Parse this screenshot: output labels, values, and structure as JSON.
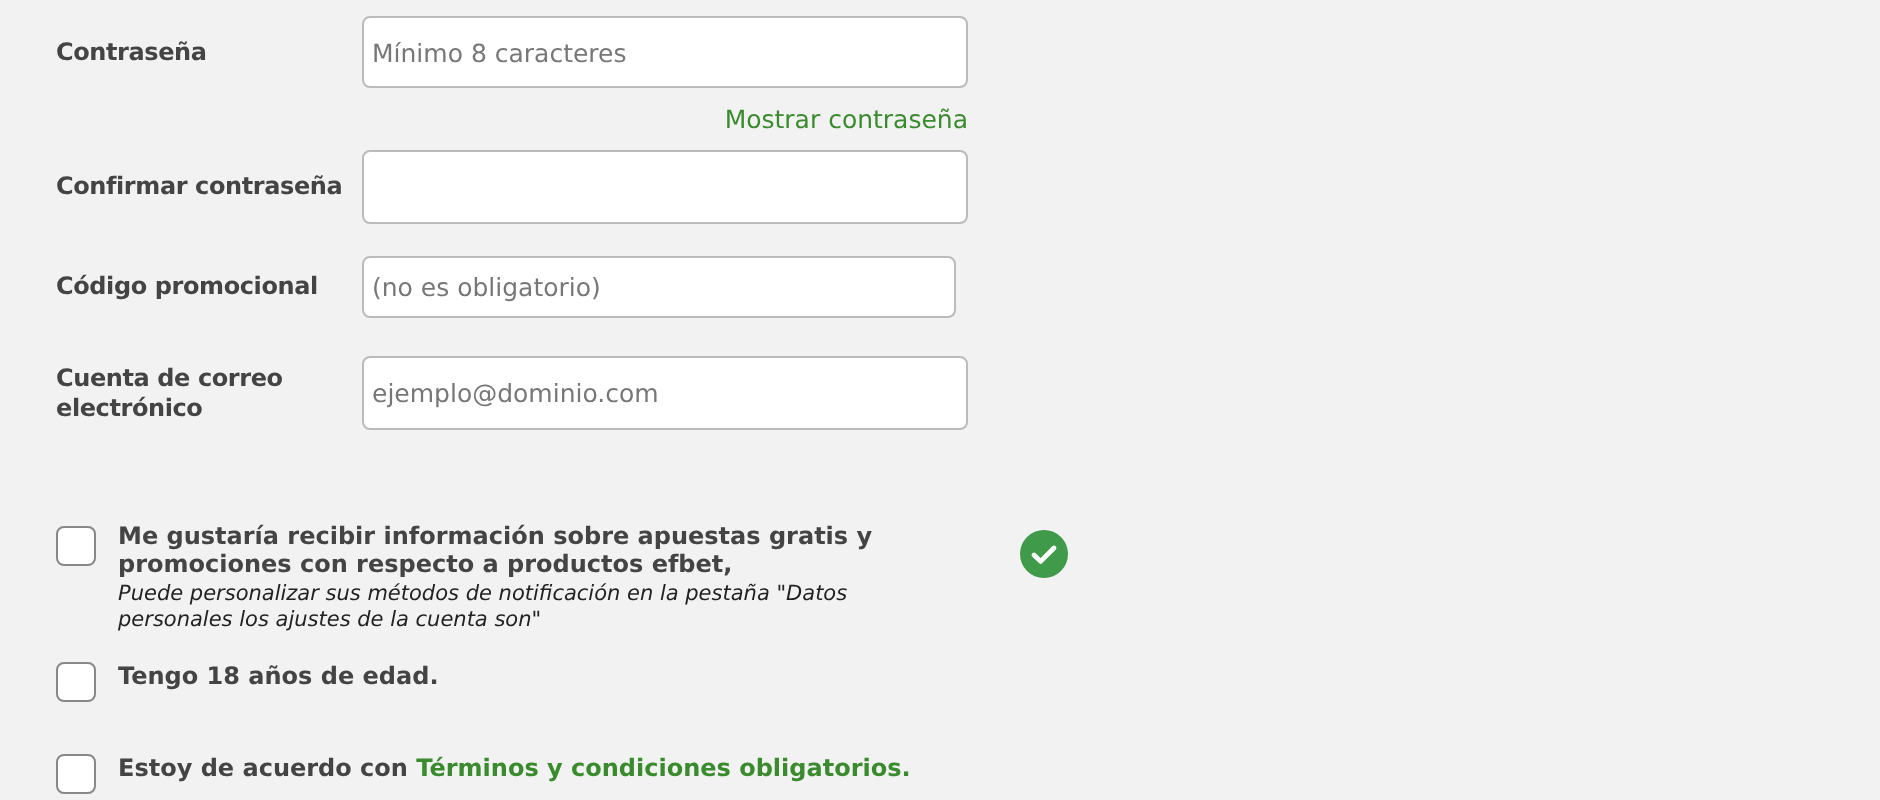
{
  "fields": [
    {
      "label": "Contraseña",
      "placeholder": "Mínimo 8 caracteres",
      "link": "Mostrar contraseña"
    },
    {
      "label": "Confirmar contraseña"
    },
    {
      "label": "Código promocional",
      "placeholder": "(no es obligatorio)"
    },
    {
      "label": "Cuenta de correo electrónico",
      "placeholder": "ejemplo@dominio.com"
    }
  ],
  "agreements": [
    {
      "text": "Me gustaría recibir información sobre apuestas gratis y promociones con respecto a productos efbet,",
      "note": "Puede personalizar sus métodos de notificación en la pestaña \"Datos personales los ajustes de la cuenta son\"",
      "checked": false,
      "valid": true
    },
    {
      "text": "Tengo 18 años de edad.",
      "checked": false,
      "valid": false
    },
    {
      "text": "Estoy de acuerdo con",
      "link": "Términos y condiciones obligatorios.",
      "checked": false,
      "valid": false
    }
  ]
}
